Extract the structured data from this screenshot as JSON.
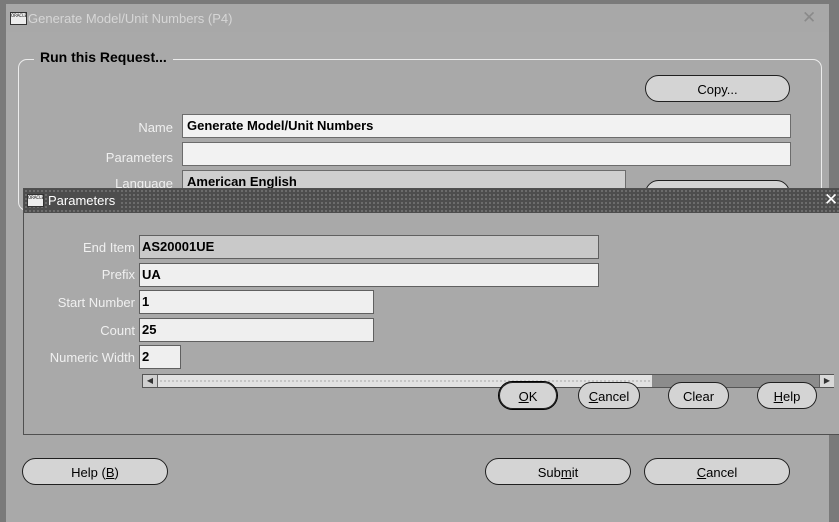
{
  "window": {
    "title": "Generate Model/Unit Numbers (P4)",
    "icon_text": "ORACLE"
  },
  "request": {
    "group_title": "Run this Request...",
    "copy_label": "Copy...",
    "name_label": "Name",
    "name_value": "Generate Model/Unit Numbers",
    "parameters_label": "Parameters",
    "parameters_value": "",
    "language_label": "Language",
    "language_value": "American English"
  },
  "footer": {
    "help_prefix": "Help (",
    "help_key": "B",
    "help_suffix": ")",
    "submit_prefix": "Sub",
    "submit_key": "m",
    "submit_suffix": "it",
    "cancel_key": "C",
    "cancel_rest": "ancel"
  },
  "dialog": {
    "title": "Parameters",
    "icon_text": "ORACLE",
    "fields": {
      "end_item_label": "End Item",
      "end_item_value": "AS20001UE",
      "prefix_label": "Prefix",
      "prefix_value": "UA",
      "start_number_label": "Start Number",
      "start_number_value": "1",
      "count_label": "Count",
      "count_value": "25",
      "numeric_width_label": "Numeric Width",
      "numeric_width_value": "2"
    },
    "buttons": {
      "ok_key": "O",
      "ok_rest": "K",
      "cancel_key": "C",
      "cancel_rest": "ancel",
      "clear_label": "Clear",
      "help_key": "H",
      "help_rest": "elp"
    }
  }
}
